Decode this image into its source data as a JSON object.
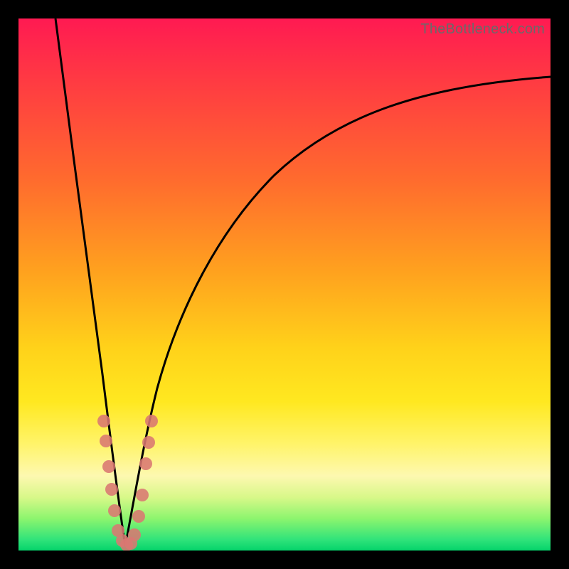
{
  "watermark": "TheBottleneck.com",
  "colors": {
    "frame": "#000000",
    "curve": "#000000",
    "dot": "#d97772",
    "gradient_top": "#ff1a52",
    "gradient_bottom": "#05d36b"
  },
  "chart_data": {
    "type": "line",
    "title": "",
    "xlabel": "",
    "ylabel": "",
    "xlim": [
      0,
      100
    ],
    "ylim": [
      0,
      100
    ],
    "series": [
      {
        "name": "left-branch",
        "x": [
          7,
          9,
          11,
          13,
          15,
          16,
          17,
          18,
          19,
          20
        ],
        "y": [
          100,
          82,
          64,
          48,
          34,
          27,
          20,
          13,
          6,
          0
        ]
      },
      {
        "name": "right-branch",
        "x": [
          20,
          21,
          22,
          23,
          25,
          28,
          32,
          38,
          46,
          56,
          68,
          80,
          90,
          100
        ],
        "y": [
          0,
          6,
          12,
          18,
          27,
          38,
          49,
          59,
          68,
          75,
          81,
          85,
          87.5,
          89
        ]
      }
    ],
    "points": [
      {
        "x": 16.0,
        "y": 24
      },
      {
        "x": 16.3,
        "y": 20
      },
      {
        "x": 16.8,
        "y": 15
      },
      {
        "x": 17.3,
        "y": 11
      },
      {
        "x": 17.8,
        "y": 7
      },
      {
        "x": 18.6,
        "y": 3
      },
      {
        "x": 19.3,
        "y": 1.5
      },
      {
        "x": 20.0,
        "y": 0.8
      },
      {
        "x": 20.8,
        "y": 1.0
      },
      {
        "x": 21.6,
        "y": 2.5
      },
      {
        "x": 22.4,
        "y": 6
      },
      {
        "x": 23.0,
        "y": 10
      },
      {
        "x": 23.8,
        "y": 16
      },
      {
        "x": 24.3,
        "y": 20
      },
      {
        "x": 24.8,
        "y": 24
      }
    ]
  }
}
